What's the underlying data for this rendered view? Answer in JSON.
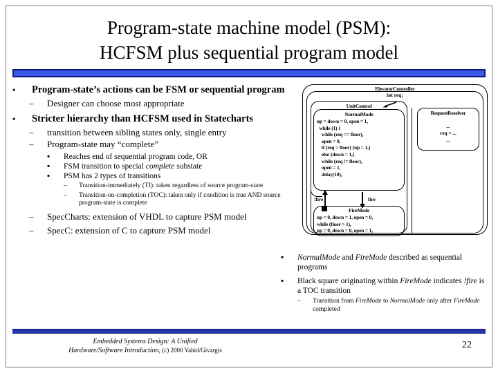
{
  "slide": {
    "title_line1": "Program-state machine model (PSM):",
    "title_line2": "HCFSM plus sequential program model",
    "page_number": "22",
    "accent_color": "#3A5BE8",
    "accent_dark": "#2436B4"
  },
  "bullets": {
    "b1": "Program-state’s actions can be FSM or sequential program",
    "b1a": "Designer can choose most appropriate",
    "b2": "Stricter hierarchy than HCFSM used in Statecharts",
    "b2a": "transition between sibling states only, single entry",
    "b2b": "Program-state may “complete”",
    "b2b1": "Reaches end of sequential program code, OR",
    "b2b2_pre": "FSM transition to special ",
    "b2b2_em": "complete",
    "b2b2_post": " substate",
    "b2b3": "PSM has 2 types of transitions",
    "b2b3a": "Transition-immediately (TI): taken regardless of source program-state",
    "b2b3b": "Transition-on-completion (TOC): taken only if condition is true AND source program-state is complete",
    "b2c": "SpecCharts: extension of VHDL to capture PSM model",
    "b2d": "SpecC: extension of C to capture PSM model"
  },
  "right_bullets": {
    "r1_a": "NormalMode",
    "r1_b": " and ",
    "r1_c": "FireMode",
    "r1_d": "  described as sequential programs",
    "r2_a": "Black square originating within ",
    "r2_b": "FireMode",
    "r2_c": " indicates ",
    "r2_d": "!fire",
    "r2_e": " is a TOC transition",
    "r2_sub_a": "Transition from ",
    "r2_sub_b": "FireMode",
    "r2_sub_c": " to ",
    "r2_sub_d": "NormalMode",
    "r2_sub_e": " only after ",
    "r2_sub_f": "FireMode",
    "r2_sub_g": " completed"
  },
  "diagram": {
    "controller_name": "ElevatorController",
    "controller_var": "int req;",
    "unit_control_name": "UnitControl",
    "normal_mode_name": "NormalMode",
    "normal_mode_code": "up = down = 0, open = 1,\n  while (1) {\n    while (req == floor),\n    open = 0,\n    if (req > floor) {up = 1,}\n    else {down = 1,}\n    while (req != floor),\n    open = 1,\n    delay(10),",
    "fire_mode_name": "FireMode",
    "fire_mode_code": "up = 0, down = 1, open = 0,\nwhile (floor > 1),\nup = 0, down = 0, open = 1,",
    "request_resolver_name": "RequestResolver",
    "request_resolver_code_1": "...",
    "request_resolver_code_2": "req = ...",
    "request_resolver_code_3": "...",
    "transition_label_up": "!fire",
    "transition_label_down": "fire"
  },
  "footer": {
    "line1": "Embedded Systems Design: A Unified",
    "line2": "Hardware/Software Introduction,",
    "line2_plain": " (c) 2000 Vahid/Givargis"
  }
}
